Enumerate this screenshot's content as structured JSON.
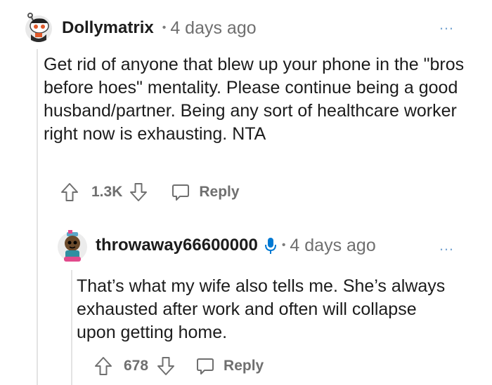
{
  "comment": {
    "username": "Dollymatrix",
    "separator": "•",
    "time": "4 days ago",
    "more": "…",
    "body": "Get rid of anyone that blew up your phone in the \"bros before hoes\" mentality. Please continue being a good husband/partner. Being any sort of healthcare worker right now is exhausting. NTA",
    "votes": "1.3K",
    "reply_label": "Reply"
  },
  "reply": {
    "username": "throwaway66600000",
    "separator": "•",
    "time": "4 days ago",
    "more": "…",
    "body": "That’s what my wife also tells me. She’s always exhausted after work and often will collapse upon getting home.",
    "votes": "678",
    "reply_label": "Reply"
  },
  "colors": {
    "text": "#1c1c1c",
    "meta": "#6f6f6f",
    "more": "#79a6d2",
    "mic": "#0079d3"
  }
}
